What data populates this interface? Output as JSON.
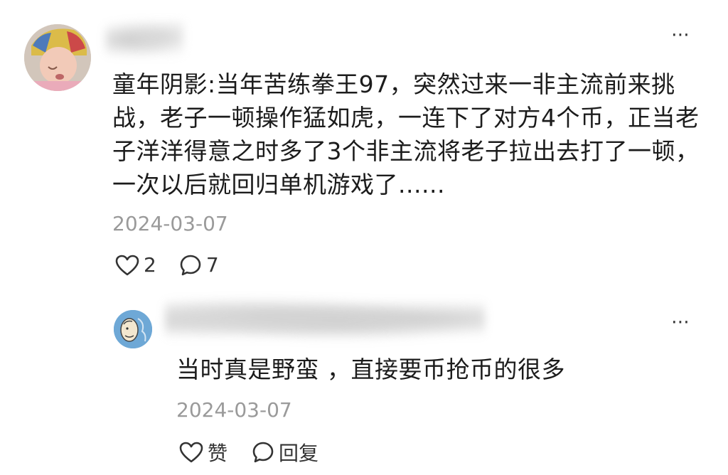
{
  "main_comment": {
    "text": "童年阴影:当年苦练拳王97，突然过来一非主流前来挑战，老子一顿操作猛如虎，一连下了对方4个币，正当老子洋洋得意之时多了3个非主流将老子拉出去打了一顿，一次以后就回归单机游戏了......",
    "date": "2024-03-07",
    "like_count": "2",
    "reply_count": "7",
    "icons": {
      "avatar": "baby-photo-avatar",
      "more": "more-dots-icon",
      "like": "heart-outline-icon",
      "reply": "speech-bubble-icon"
    }
  },
  "reply": {
    "text": "当时真是野蛮 ，直接要币抢币的很多",
    "date": "2024-03-07",
    "like_label": "赞",
    "reply_label": "回复",
    "icons": {
      "avatar": "cartoon-avatar",
      "more": "more-dots-icon",
      "like": "heart-outline-icon",
      "reply": "speech-bubble-icon"
    }
  },
  "more_symbol": "⋯",
  "colors": {
    "text": "#1c1c1c",
    "secondary_text": "#9a9a9a",
    "icon": "#333333",
    "background": "#ffffff"
  }
}
